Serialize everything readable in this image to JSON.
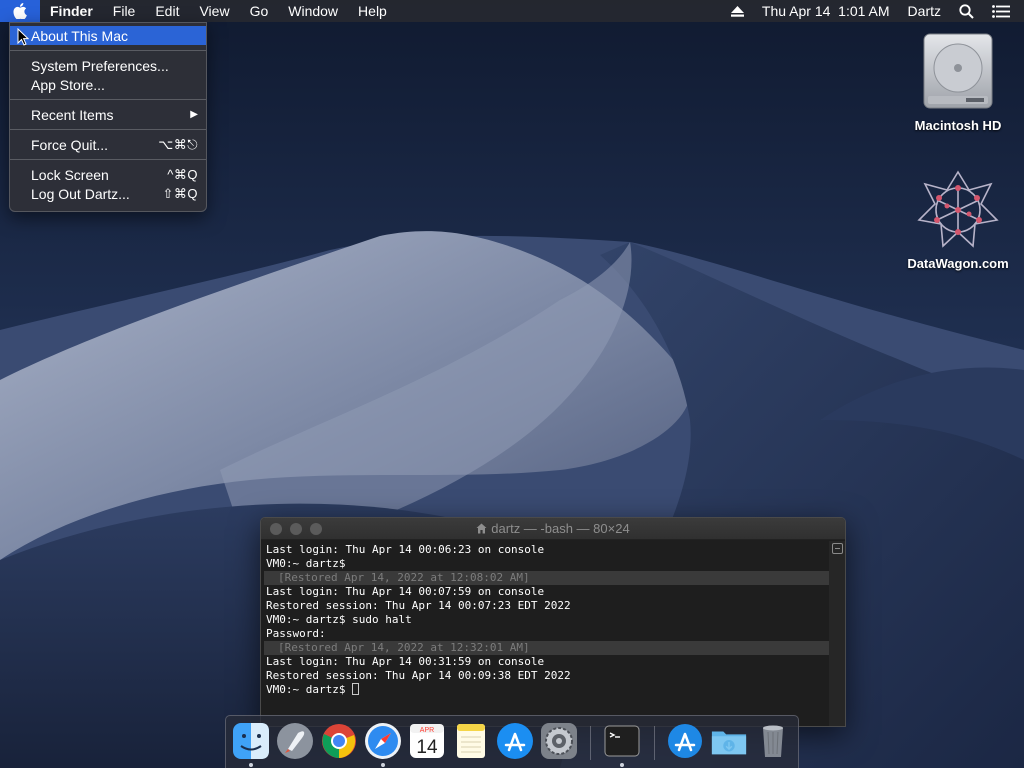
{
  "menubar": {
    "apple_icon": "apple-icon",
    "items": [
      "Finder",
      "File",
      "Edit",
      "View",
      "Go",
      "Window",
      "Help"
    ],
    "eject_icon": "eject-icon",
    "clock": "Thu Apr 14  1:01 AM",
    "user": "Dartz",
    "search_icon": "search-icon",
    "list_icon": "notification-center-icon"
  },
  "apple_menu": {
    "items": [
      {
        "label": "About This Mac",
        "shortcut": "",
        "highlight": true
      },
      {
        "label": "System Preferences...",
        "shortcut": ""
      },
      {
        "label": "App Store...",
        "shortcut": ""
      },
      {
        "label": "Recent Items",
        "shortcut": "▶"
      },
      {
        "label": "Force Quit...",
        "shortcut": "⌥⌘⎋"
      },
      {
        "label": "Lock Screen",
        "shortcut": "^⌘Q"
      },
      {
        "label": "Log Out Dartz...",
        "shortcut": "⇧⌘Q"
      }
    ]
  },
  "desktop": {
    "icons": [
      {
        "label": "Macintosh HD",
        "icon": "hard-drive-icon"
      },
      {
        "label": "DataWagon.com",
        "icon": "datawagon-logo-icon"
      }
    ]
  },
  "terminal": {
    "title": "dartz — -bash — 80×24",
    "lines": [
      {
        "text": "Last login: Thu Apr 14 00:06:23 on console",
        "type": "normal"
      },
      {
        "text": "VM0:~ dartz$",
        "type": "normal"
      },
      {
        "text": "[Restored Apr 14, 2022 at 12:08:02 AM]",
        "type": "restored"
      },
      {
        "text": "Last login: Thu Apr 14 00:07:59 on console",
        "type": "normal"
      },
      {
        "text": "Restored session: Thu Apr 14 00:07:23 EDT 2022",
        "type": "normal"
      },
      {
        "text": "VM0:~ dartz$ sudo halt",
        "type": "normal"
      },
      {
        "text": "Password:",
        "type": "normal"
      },
      {
        "text": "[Restored Apr 14, 2022 at 12:32:01 AM]",
        "type": "restored"
      },
      {
        "text": "Last login: Thu Apr 14 00:31:59 on console",
        "type": "normal"
      },
      {
        "text": "Restored session: Thu Apr 14 00:09:38 EDT 2022",
        "type": "normal"
      },
      {
        "text": "VM0:~ dartz$ ",
        "type": "prompt"
      }
    ]
  },
  "dock": {
    "apps": [
      {
        "name": "Finder",
        "icon": "finder-icon",
        "running": true
      },
      {
        "name": "Launchpad",
        "icon": "launchpad-icon",
        "running": false
      },
      {
        "name": "Google Chrome",
        "icon": "chrome-icon",
        "running": false
      },
      {
        "name": "Safari",
        "icon": "safari-icon",
        "running": true
      },
      {
        "name": "Calendar",
        "icon": "calendar-icon",
        "running": false,
        "month": "APR",
        "day": "14"
      },
      {
        "name": "Notes",
        "icon": "notes-icon",
        "running": false
      },
      {
        "name": "App Store",
        "icon": "app-store-icon",
        "running": false
      },
      {
        "name": "System Preferences",
        "icon": "system-preferences-icon",
        "running": false
      },
      {
        "name": "Terminal",
        "icon": "terminal-icon",
        "running": true
      },
      {
        "name": "Applications",
        "icon": "applications-folder-icon",
        "running": false
      },
      {
        "name": "Downloads",
        "icon": "downloads-folder-icon",
        "running": false
      },
      {
        "name": "Trash",
        "icon": "trash-icon",
        "running": false
      }
    ]
  },
  "colors": {
    "highlight": "#2b64d6",
    "menubar_bg": "#26282f",
    "terminal_bg": "#1e1e1e"
  }
}
